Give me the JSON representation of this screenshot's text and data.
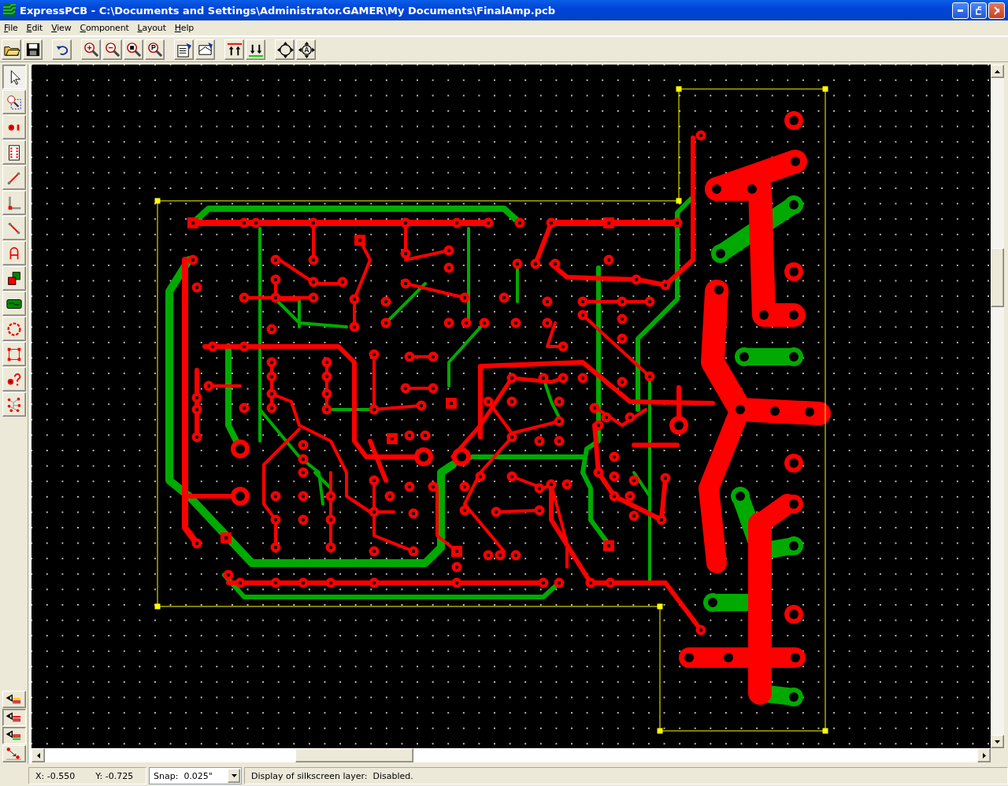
{
  "window": {
    "title": "ExpressPCB - C:\\Documents and Settings\\Administrator.GAMER\\My Documents\\FinalAmp.pcb"
  },
  "menu": [
    "File",
    "Edit",
    "View",
    "Component",
    "Layout",
    "Help"
  ],
  "tools": [
    {
      "kind": "pointer",
      "selected": true
    },
    {
      "kind": "zoom-area",
      "selected": false
    },
    {
      "kind": "pad",
      "selected": false
    },
    {
      "kind": "component",
      "selected": false
    },
    {
      "kind": "trace",
      "selected": false
    },
    {
      "kind": "corner",
      "selected": false
    },
    {
      "kind": "segment",
      "selected": false
    },
    {
      "kind": "text",
      "selected": false
    },
    {
      "kind": "layers",
      "selected": false
    },
    {
      "kind": "fill",
      "selected": false
    },
    {
      "kind": "circle",
      "selected": false
    },
    {
      "kind": "rectangle",
      "selected": false
    },
    {
      "kind": "pad-query",
      "selected": false
    },
    {
      "kind": "netlist",
      "selected": false
    }
  ],
  "layer_buttons": [
    {
      "kind": "silkscreen",
      "pressed": false
    },
    {
      "kind": "top-copper",
      "pressed": true
    },
    {
      "kind": "bottom-copper",
      "pressed": true
    },
    {
      "kind": "ratsnest",
      "pressed": false
    }
  ],
  "status_bar": {
    "x": "X: -0.550",
    "y": "Y: -0.725",
    "snap": "Snap:  0.025\"",
    "message": "Display of silkscreen layer:  Disabled."
  }
}
